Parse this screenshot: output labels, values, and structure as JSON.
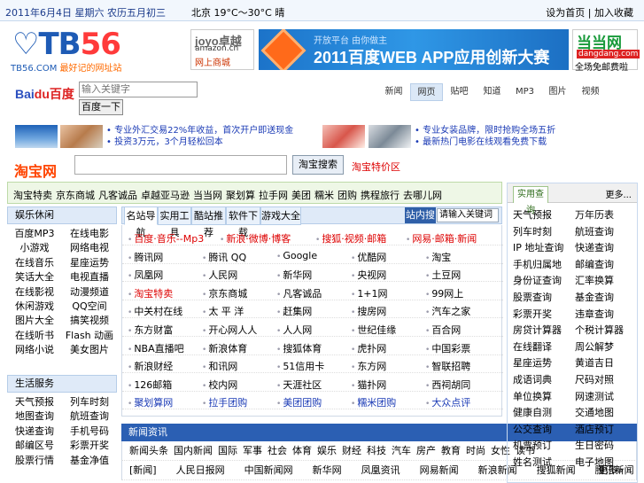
{
  "topbar": {
    "date": "2011年6月4日 星期六 农历五月初三",
    "weather": "北京 19°C～30°C 晴",
    "links": [
      "设为首页",
      "加入收藏"
    ],
    "sep": "|"
  },
  "logo": {
    "mark_a": "TB",
    "mark_b": "56",
    "sub_site": "TB56.COM",
    "sub_slogan": "最好记的网址站"
  },
  "ads": {
    "joyo": {
      "line1": "joyo卓越",
      "line2": "amazon.cn",
      "line3": "网上商城"
    },
    "baidu_app": {
      "small": "开放平台 由你做主",
      "big": "2011百度WEB APP应用创新大赛"
    },
    "dangdang": {
      "line1": "当当网",
      "line2": "dangdang.com",
      "line3": "全场免邮费啦"
    }
  },
  "baidu": {
    "logo_a": "Bai",
    "logo_b": "du百度",
    "input_placeholder": "输入关键字",
    "button": "百度一下",
    "tabs": [
      "新闻",
      "网页",
      "贴吧",
      "知道",
      "MP3",
      "图片",
      "视频"
    ],
    "active_tab": 1
  },
  "promos": [
    "专业外汇交易22%年收益，首次开户即送现金",
    "投资3万元，3个月轻松回本",
    "专业女装品牌，限时抢购全场五折",
    "最新热门电影在线观看免费下载"
  ],
  "taobao": {
    "logo": "淘宝网",
    "button": "淘宝搜索",
    "link": "淘宝特价区"
  },
  "hotbar": [
    "淘宝特卖",
    "京东商城",
    "凡客诚品",
    "卓越亚马逊",
    "当当网",
    "聚划算",
    "拉手网",
    "美团",
    "糯米",
    "团购",
    "携程旅行",
    "去哪儿网"
  ],
  "left": {
    "title1": "娱乐休闲",
    "items1": [
      "百度MP3",
      "在线电影",
      "小游戏",
      "网络电视",
      "在线音乐",
      "星座运势",
      "笑话大全",
      "电视直播",
      "在线影视",
      "动漫频道",
      "休闲游戏",
      "QQ空间",
      "图片大全",
      "搞笑视频",
      "在线听书",
      "Flash 动画",
      "网络小说",
      "美女图片"
    ],
    "title2": "生活服务",
    "items2": [
      "天气预报",
      "列车时刻",
      "地图查询",
      "航班查询",
      "快递查询",
      "手机号码",
      "邮编区号",
      "彩票开奖",
      "股票行情",
      "基金净值"
    ]
  },
  "mid": {
    "tabs": [
      "名站导航",
      "实用工具",
      "酷站推荐",
      "软件下载",
      "游戏大全"
    ],
    "active_tab": 0,
    "search_btn": "站内搜索",
    "search_input": "请输入关键词",
    "rows": [
      [
        "百度·音乐--Mp3",
        "新浪·微博·博客",
        "搜狐·视频·邮箱",
        "网易·邮箱·新闻"
      ],
      [
        "腾讯网",
        "腾讯 QQ",
        "Google",
        "优酷网",
        "淘宝"
      ],
      [
        "凤凰网",
        "人民网",
        "新华网",
        "央视网",
        "土豆网"
      ],
      [
        "淘宝特卖",
        "京东商城",
        "凡客诚品",
        "1+1网",
        "99网上"
      ],
      [
        "中关村在线",
        "太 平 洋",
        "赶集网",
        "搜房网",
        "汽车之家"
      ],
      [
        "东方财富",
        "开心网人人",
        "人人网",
        "世纪佳缘",
        "百合网"
      ],
      [
        "NBA直播吧",
        "新浪体育",
        "搜狐体育",
        "虎扑网",
        "中国彩票"
      ],
      [
        "新浪财经",
        "和讯网",
        "51信用卡",
        "东方网",
        "智联招聘"
      ],
      [
        "126邮箱",
        "校内网",
        "天涯社区",
        "猫扑网",
        "西祠胡同"
      ],
      [
        "聚划算网",
        "拉手团购",
        "美团团购",
        "糯米团购",
        "大众点评"
      ]
    ]
  },
  "news": {
    "title": "新闻资讯",
    "row1": [
      "新闻头条",
      "国内新闻",
      "国际",
      "军事",
      "社会",
      "体育",
      "娱乐",
      "财经",
      "科技",
      "汽车",
      "房产",
      "教育",
      "时尚",
      "女性",
      "读书"
    ],
    "row2": [
      "[新闻]",
      "人民日报网",
      "中国新闻网",
      "新华网",
      "凤凰资讯",
      "网易新闻",
      "新浪新闻",
      "搜狐新闻",
      "腾讯新闻"
    ],
    "more": "更多»"
  },
  "right": {
    "tab": "实用查询",
    "more": "更多...",
    "items": [
      "天气预报",
      "万年历表",
      "列车时刻",
      "航班查询",
      "IP 地址查询",
      "快递查询",
      "手机归属地",
      "邮编查询",
      "身份证查询",
      "汇率换算",
      "股票查询",
      "基金查询",
      "彩票开奖",
      "违章查询",
      "房贷计算器",
      "个税计算器",
      "在线翻译",
      "周公解梦",
      "星座运势",
      "黄道吉日",
      "成语词典",
      "尺码对照",
      "单位换算",
      "网速测试",
      "健康自测",
      "交通地图",
      "公交查询",
      "酒店预订",
      "机票预订",
      "生日密码",
      "姓名测试",
      "电子地图"
    ]
  }
}
